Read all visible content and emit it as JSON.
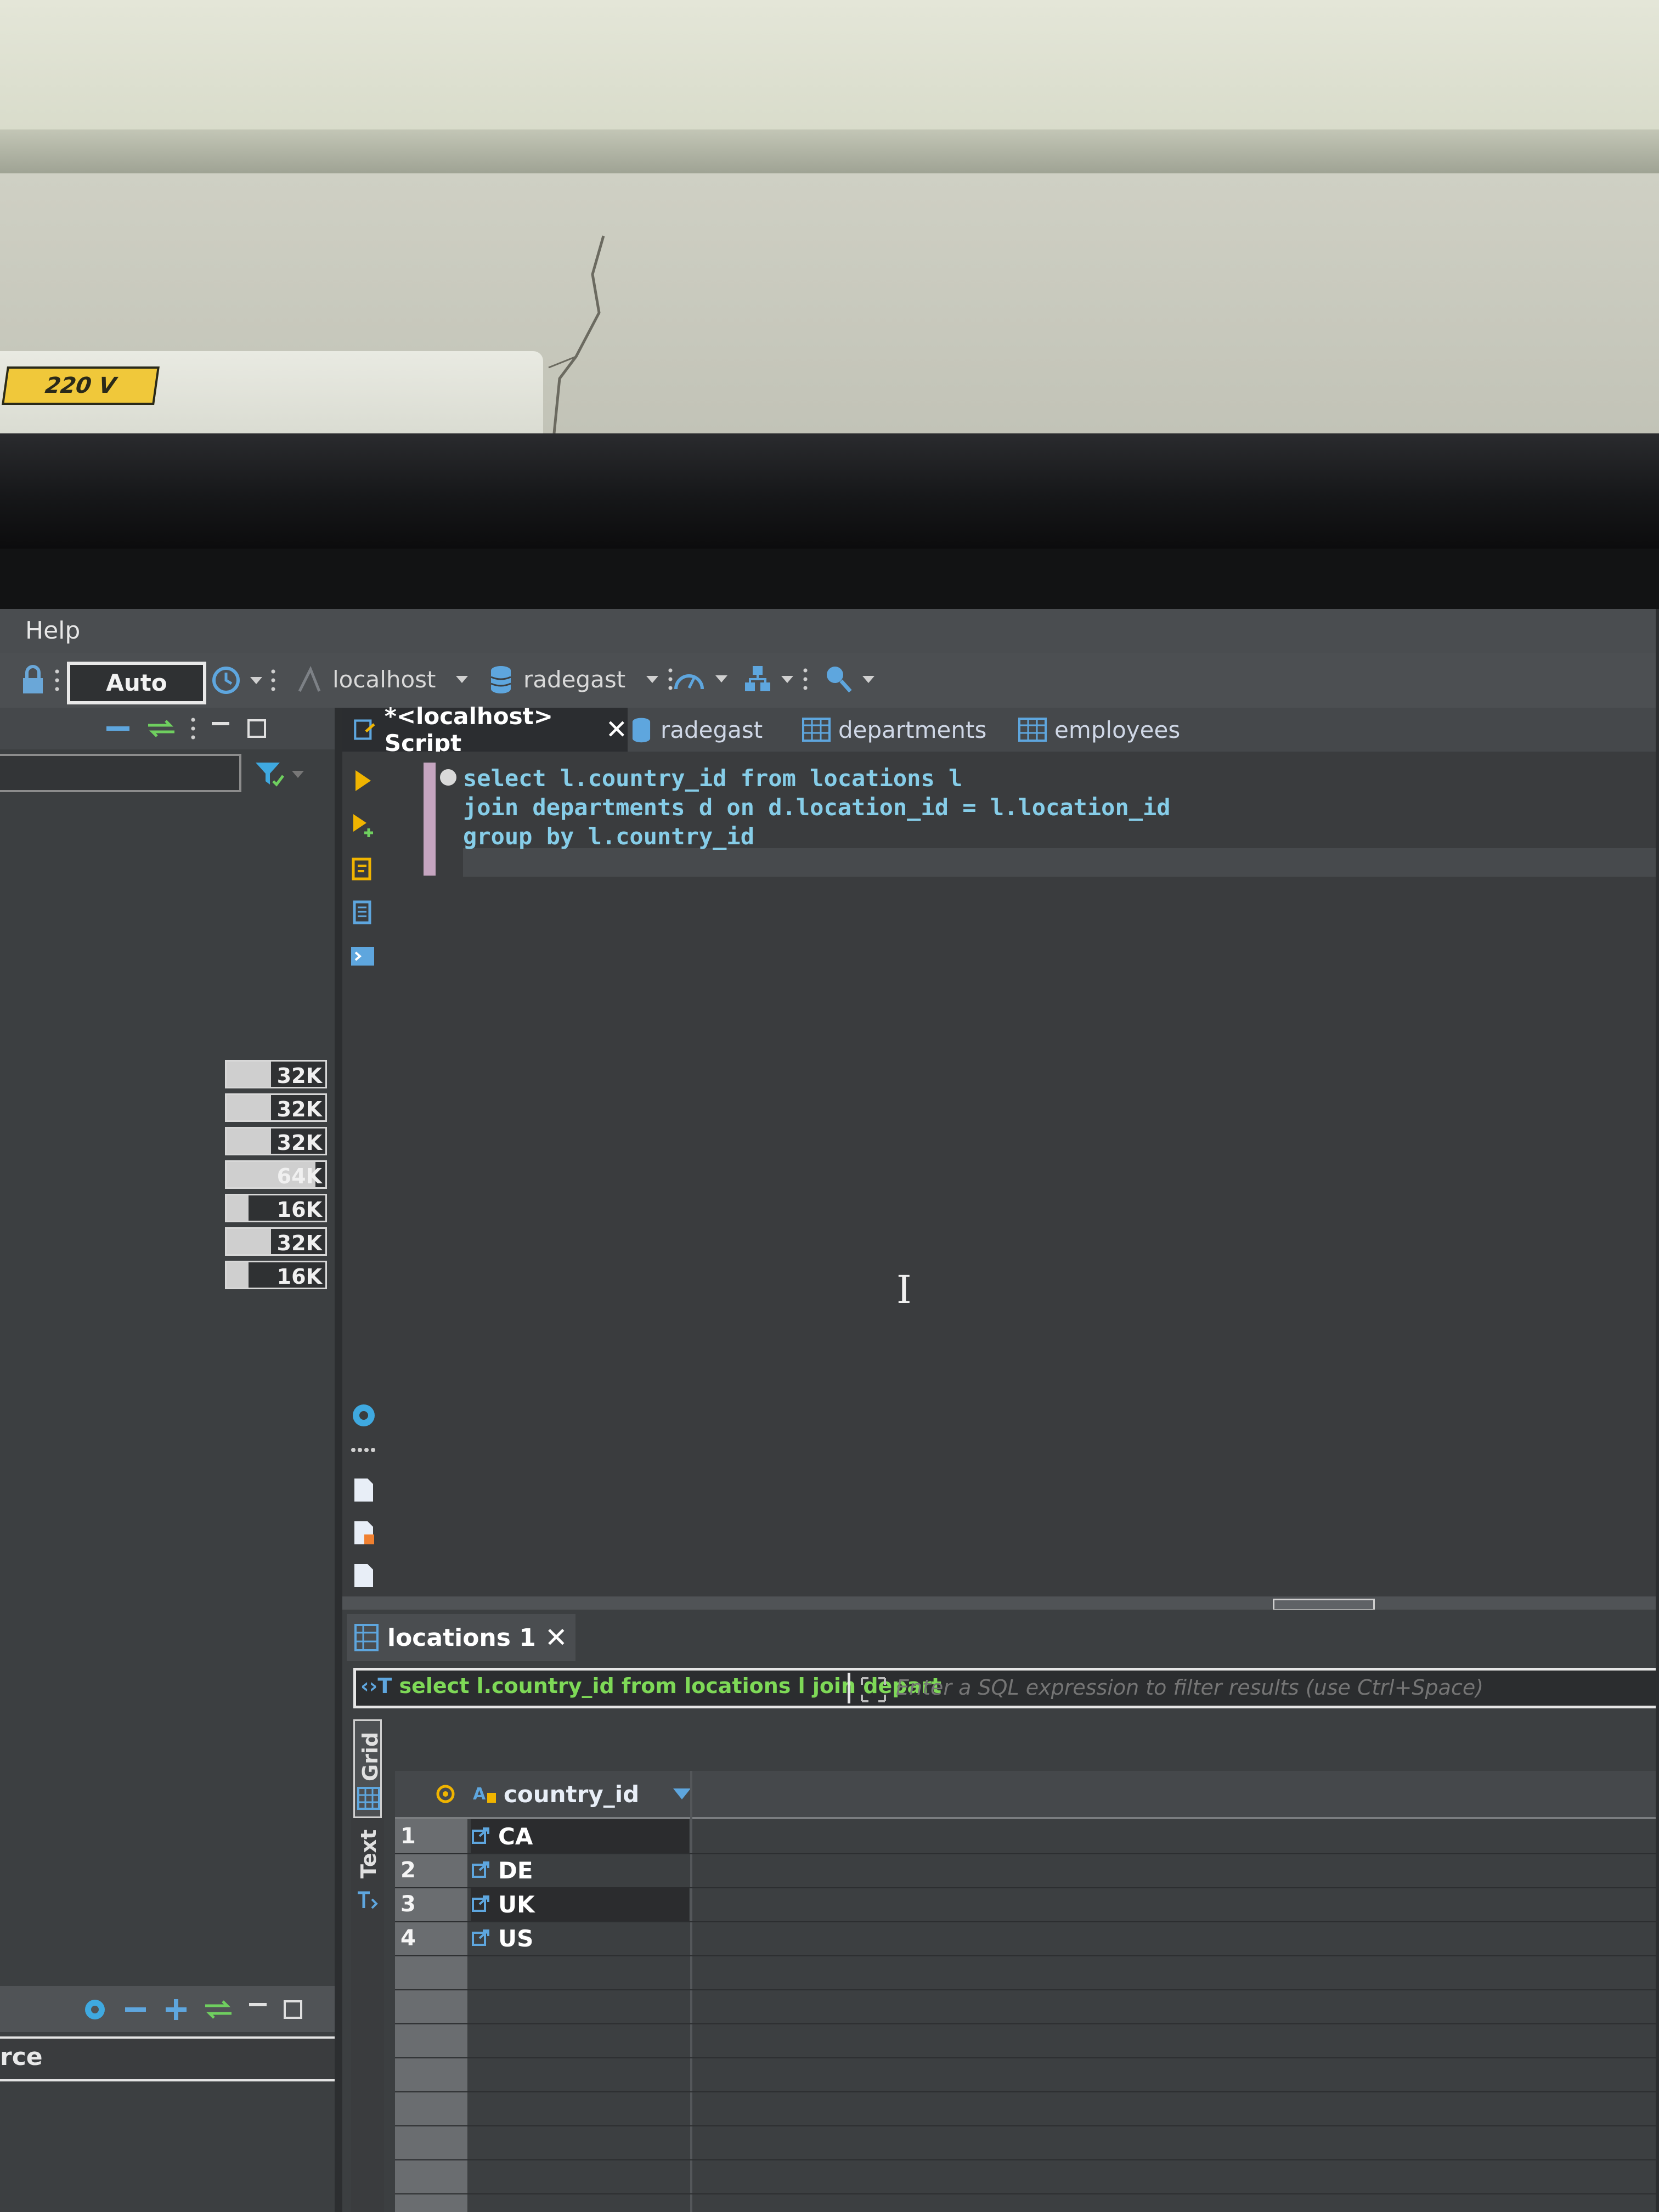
{
  "environment": {
    "voltage_label": "220 V"
  },
  "menu": {
    "help": "Help"
  },
  "toolbar": {
    "commit_mode": "Auto",
    "connection": "localhost",
    "database": "radegast"
  },
  "left_panel": {
    "sizes": [
      {
        "label": "32K",
        "fill": 0.45
      },
      {
        "label": "32K",
        "fill": 0.45
      },
      {
        "label": "32K",
        "fill": 0.45
      },
      {
        "label": "64K",
        "fill": 0.9
      },
      {
        "label": "16K",
        "fill": 0.22
      },
      {
        "label": "32K",
        "fill": 0.45
      },
      {
        "label": "16K",
        "fill": 0.22
      }
    ],
    "bottom_label": "rce"
  },
  "editor_tabs": [
    {
      "label": "*<localhost> Script",
      "active": true,
      "icon": "script-icon"
    },
    {
      "label": "radegast",
      "active": false,
      "icon": "database-icon"
    },
    {
      "label": "departments",
      "active": false,
      "icon": "table-icon"
    },
    {
      "label": "employees",
      "active": false,
      "icon": "table-icon"
    }
  ],
  "editor": {
    "lines": [
      "select l.country_id from locations l",
      "join departments d on d.location_id = l.location_id",
      "group by l.country_id"
    ]
  },
  "results": {
    "tab_label": "locations 1",
    "query_preview": "select l.country_id from locations l join depart",
    "filter_placeholder": "Enter a SQL expression to filter results (use Ctrl+Space)",
    "view_tabs": {
      "grid": "Grid",
      "text": "Text"
    },
    "column": "country_id",
    "rows": [
      {
        "num": "1",
        "value": "CA"
      },
      {
        "num": "2",
        "value": "DE"
      },
      {
        "num": "3",
        "value": "UK"
      },
      {
        "num": "4",
        "value": "US"
      }
    ]
  },
  "colors": {
    "accent": "#5a9bd6",
    "sql_keyword": "#86cde8",
    "query_preview": "#7ed957"
  }
}
